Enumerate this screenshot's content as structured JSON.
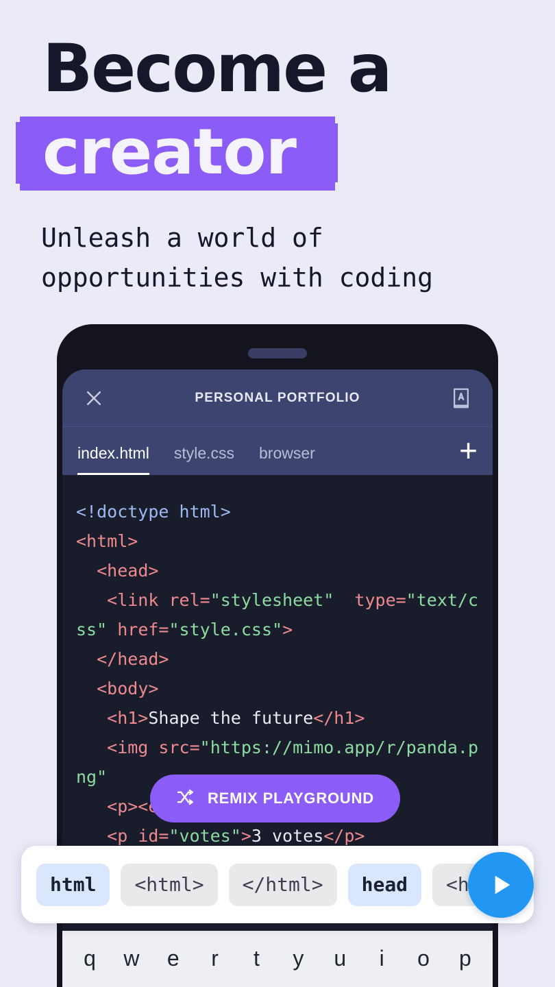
{
  "hero": {
    "line1": "Become a",
    "line2": "creator",
    "highlight_color": "#8B5CF6",
    "subtitle_line1": "Unleash a world of",
    "subtitle_line2": "opportunities with coding"
  },
  "phone": {
    "app_bar": {
      "close_icon": "close-icon",
      "title": "PERSONAL PORTFOLIO",
      "glossary_icon": "book-a-icon"
    },
    "tabs": [
      {
        "label": "index.html",
        "active": true
      },
      {
        "label": "style.css",
        "active": false
      },
      {
        "label": "browser",
        "active": false
      }
    ],
    "add_tab_label": "+",
    "editor": {
      "language": "html",
      "lines": [
        [
          {
            "t": "<!doctype html>",
            "c": "doctype"
          }
        ],
        [
          {
            "t": "<html>",
            "c": "tag"
          }
        ],
        [
          {
            "t": "  <head>",
            "c": "tag"
          }
        ],
        [
          {
            "t": "   <link ",
            "c": "tag"
          },
          {
            "t": "rel=",
            "c": "attr"
          },
          {
            "t": "\"stylesheet\"",
            "c": "str"
          },
          {
            "t": "  type=",
            "c": "attr"
          },
          {
            "t": "\"text/css\" ",
            "c": "str"
          },
          {
            "t": "href=",
            "c": "attr"
          },
          {
            "t": "\"style.css\"",
            "c": "str"
          },
          {
            "t": ">",
            "c": "tag"
          }
        ],
        [
          {
            "t": "  </head>",
            "c": "tag"
          }
        ],
        [
          {
            "t": "  <body>",
            "c": "tag"
          }
        ],
        [
          {
            "t": "   <h1>",
            "c": "tag"
          },
          {
            "t": "Shape the future",
            "c": "txt"
          },
          {
            "t": "</h1>",
            "c": "tag"
          }
        ],
        [
          {
            "t": "   <img ",
            "c": "tag"
          },
          {
            "t": "src=",
            "c": "attr"
          },
          {
            "t": "\"https://mimo.app/r/panda.png\"",
            "c": "str"
          }
        ],
        [
          {
            "t": "   <p><em",
            "c": "tag"
          }
        ],
        [
          {
            "t": "   <p ",
            "c": "tag"
          },
          {
            "t": "id=",
            "c": "attr"
          },
          {
            "t": "\"votes\"",
            "c": "str"
          },
          {
            "t": ">",
            "c": "tag"
          },
          {
            "t": "3 votes",
            "c": "txt"
          },
          {
            "t": "</p>",
            "c": "tag"
          }
        ]
      ]
    }
  },
  "remix_button": {
    "label": "REMIX PLAYGROUND",
    "icon": "shuffle-icon",
    "color": "#8B5CF6"
  },
  "autocomplete": {
    "chips": [
      {
        "label": "html",
        "kind": "kw"
      },
      {
        "label": "<html>",
        "kind": "tg"
      },
      {
        "label": "</html>",
        "kind": "tg"
      },
      {
        "label": "head",
        "kind": "kw"
      },
      {
        "label": "<h",
        "kind": "tg"
      }
    ],
    "run_icon": "play-icon",
    "run_color": "#2196F3"
  },
  "keyboard": {
    "row1": [
      "q",
      "w",
      "e",
      "r",
      "t",
      "y",
      "u",
      "i",
      "o",
      "p"
    ]
  }
}
